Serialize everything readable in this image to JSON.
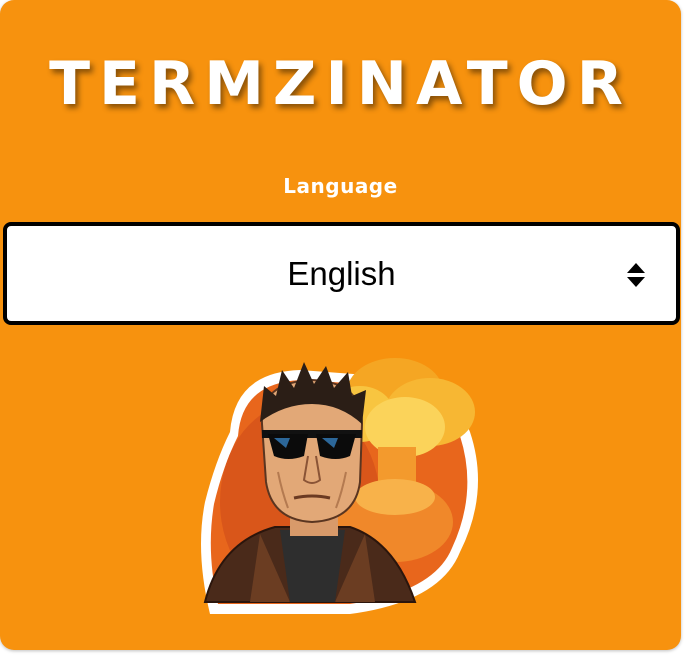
{
  "app": {
    "title": "TERMZINATOR"
  },
  "language": {
    "label": "Language",
    "selected": "English"
  },
  "icons": {
    "select_arrows": "updown-arrows-icon",
    "illustration": "terminator-mascot-illustration"
  },
  "colors": {
    "background": "#f7920e",
    "title_text": "#ffffff",
    "select_border": "#000000",
    "select_background": "#ffffff"
  }
}
